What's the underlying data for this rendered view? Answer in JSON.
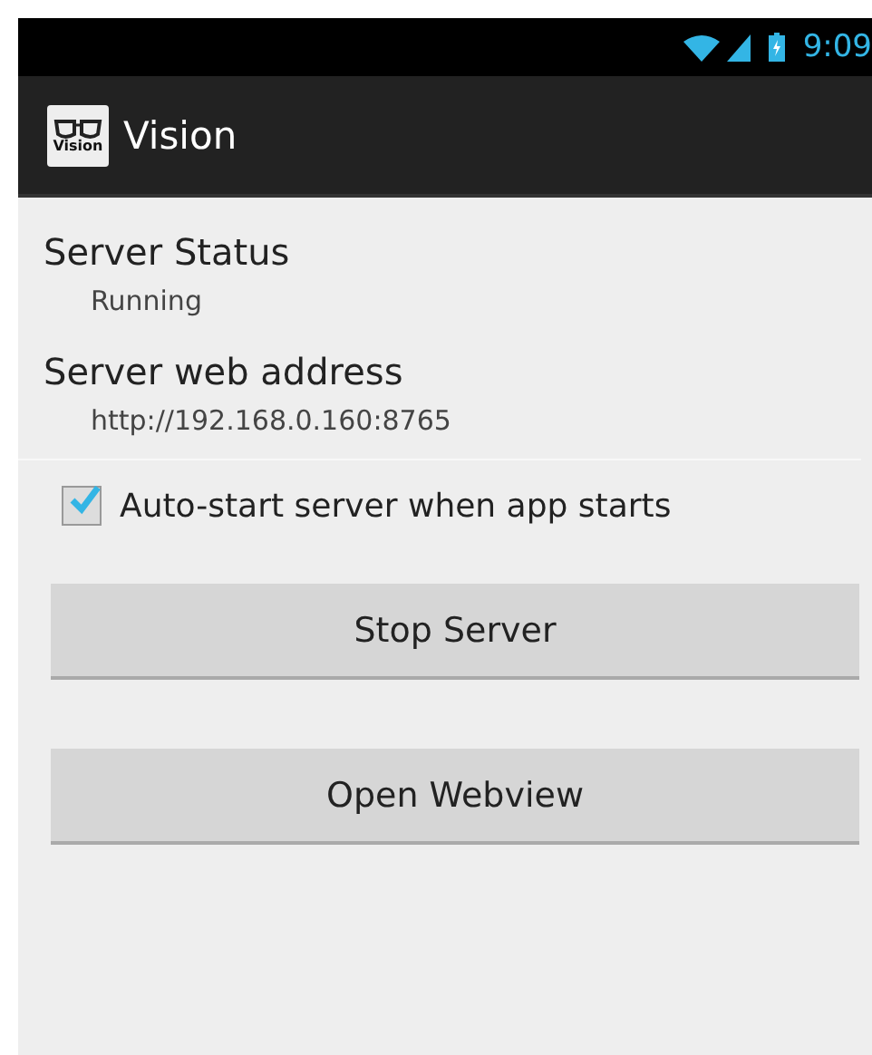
{
  "status_bar": {
    "time": "9:09"
  },
  "action_bar": {
    "icon_text": "Vision",
    "title": "Vision"
  },
  "sections": [
    {
      "title": "Server Status",
      "value": "Running"
    },
    {
      "title": "Server web address",
      "value": "http://192.168.0.160:8765"
    }
  ],
  "checkbox": {
    "label": "Auto-start server when app starts",
    "checked": true
  },
  "buttons": [
    "Stop Server",
    "Open Webview"
  ]
}
